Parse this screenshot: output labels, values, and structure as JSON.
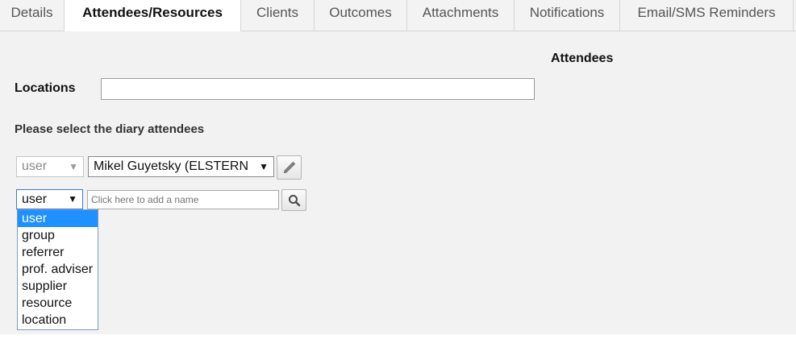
{
  "tabs": [
    {
      "label": "Details"
    },
    {
      "label": "Attendees/Resources"
    },
    {
      "label": "Clients"
    },
    {
      "label": "Outcomes"
    },
    {
      "label": "Attachments"
    },
    {
      "label": "Notifications"
    },
    {
      "label": "Email/SMS Reminders"
    }
  ],
  "active_tab": "Attendees/Resources",
  "attendees_heading": "Attendees",
  "locations": {
    "label": "Locations",
    "value": ""
  },
  "select_prompt": "Please select the diary attendees",
  "attendee_row": {
    "type": "user",
    "name": "Mikel Guyetsky (ELSTERN"
  },
  "add_row": {
    "type": "user",
    "placeholder": "Click here to add a name"
  },
  "type_options": [
    "user",
    "group",
    "referrer",
    "prof. adviser",
    "supplier",
    "resource",
    "location"
  ],
  "highlighted_option": "user",
  "icons": {
    "edit": "pencil-icon",
    "search": "magnifier-icon",
    "dropdown": "triangle-down"
  }
}
